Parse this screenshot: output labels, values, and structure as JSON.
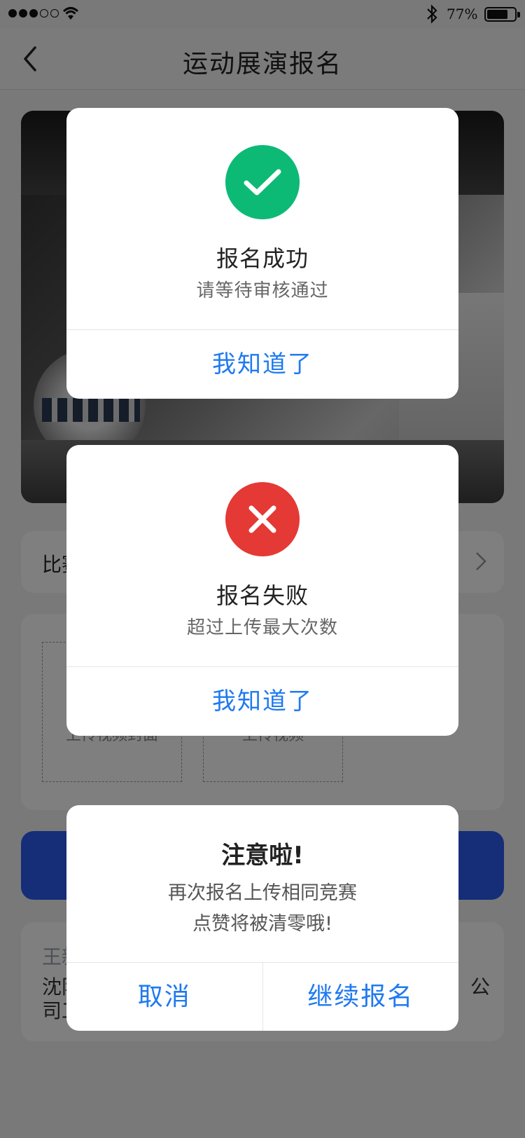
{
  "status_bar": {
    "signal_filled": 3,
    "signal_total": 5,
    "battery_text": "77%",
    "battery_level": 0.77
  },
  "nav": {
    "back_icon": "chevron-left-icon",
    "title": "运动展演报名"
  },
  "page": {
    "row_label": "比赛",
    "upload_cover_label": "上传视频封面",
    "upload_video_label": "上传视频",
    "info_name": "王新",
    "info_org": "沈阳                                                      公\n司工"
  },
  "dialogs": {
    "success": {
      "icon": "check-icon",
      "color": "#0cba76",
      "title": "报名成功",
      "subtitle": "请等待审核通过",
      "action": "我知道了"
    },
    "fail": {
      "icon": "close-icon",
      "color": "#e53935",
      "title": "报名失败",
      "subtitle": "超过上传最大次数",
      "action": "我知道了"
    },
    "warning": {
      "title": "注意啦!",
      "line1": "再次报名上传相同竞赛",
      "line2": "点赞将被清零哦!",
      "cancel": "取消",
      "confirm": "继续报名"
    }
  },
  "colors": {
    "accent": "#1f7af0",
    "submit_button": "#2c5bf0",
    "overlay": "rgba(0,0,0,0.5)"
  }
}
